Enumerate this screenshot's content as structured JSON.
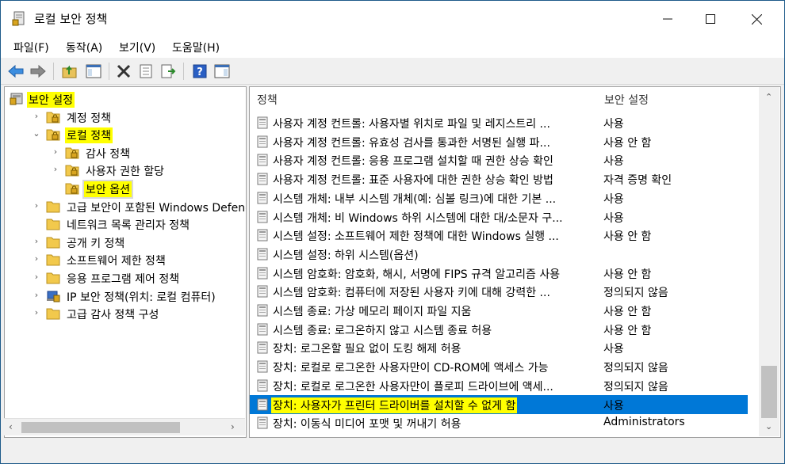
{
  "window": {
    "title": "로컬 보안 정책"
  },
  "menu": [
    "파일(F)",
    "동작(A)",
    "보기(V)",
    "도움말(H)"
  ],
  "tree": [
    {
      "label": "보안 설정",
      "level": 0,
      "arrow": "",
      "highlight": true,
      "selected": false
    },
    {
      "label": "계정 정책",
      "level": 1,
      "arrow": "›",
      "highlight": false,
      "selected": false
    },
    {
      "label": "로컬 정책",
      "level": 1,
      "arrow": "⌄",
      "highlight": true,
      "selected": false
    },
    {
      "label": "감사 정책",
      "level": 2,
      "arrow": "›",
      "highlight": false,
      "selected": false
    },
    {
      "label": "사용자 권한 할당",
      "level": 2,
      "arrow": "›",
      "highlight": false,
      "selected": false
    },
    {
      "label": "보안 옵션",
      "level": 2,
      "arrow": "",
      "highlight": true,
      "selected": true
    },
    {
      "label": "고급 보안이 포함된 Windows Defenc",
      "level": 1,
      "arrow": "›",
      "highlight": false,
      "selected": false
    },
    {
      "label": "네트워크 목록 관리자 정책",
      "level": 1,
      "arrow": "",
      "highlight": false,
      "selected": false
    },
    {
      "label": "공개 키 정책",
      "level": 1,
      "arrow": "›",
      "highlight": false,
      "selected": false
    },
    {
      "label": "소프트웨어 제한 정책",
      "level": 1,
      "arrow": "›",
      "highlight": false,
      "selected": false
    },
    {
      "label": "응용 프로그램 제어 정책",
      "level": 1,
      "arrow": "›",
      "highlight": false,
      "selected": false
    },
    {
      "label": "IP 보안 정책(위치: 로컬 컴퓨터)",
      "level": 1,
      "arrow": "›",
      "highlight": false,
      "selected": false
    },
    {
      "label": "고급 감사 정책 구성",
      "level": 1,
      "arrow": "›",
      "highlight": false,
      "selected": false
    }
  ],
  "columns": {
    "policy": "정책",
    "setting": "보안 설정"
  },
  "rows": [
    {
      "policy": "사용자 계정 컨트롤: 사용자별 위치로 파일 및 레지스트리 ...",
      "setting": "사용"
    },
    {
      "policy": "사용자 계정 컨트롤: 유효성 검사를 통과한 서명된 실행 파...",
      "setting": "사용 안 함"
    },
    {
      "policy": "사용자 계정 컨트롤: 응용 프로그램 설치할 때 권한 상승 확인",
      "setting": "사용"
    },
    {
      "policy": "사용자 계정 컨트롤: 표준 사용자에 대한 권한 상승 확인 방법",
      "setting": "자격 증명 확인"
    },
    {
      "policy": "시스템 개체: 내부 시스템 개체(예: 심볼 링크)에 대한 기본 ...",
      "setting": "사용"
    },
    {
      "policy": "시스템 개체: 비 Windows 하위 시스템에 대한 대/소문자 구...",
      "setting": "사용"
    },
    {
      "policy": "시스템 설정: 소프트웨어 제한 정책에 대한 Windows 실행 ...",
      "setting": "사용 안 함"
    },
    {
      "policy": "시스템 설정: 하위 시스템(옵션)",
      "setting": ""
    },
    {
      "policy": "시스템 암호화: 암호화, 해시, 서명에 FIPS 규격 알고리즘 사용",
      "setting": "사용 안 함"
    },
    {
      "policy": "시스템 암호화: 컴퓨터에 저장된 사용자 키에 대해 강력한 ...",
      "setting": "정의되지 않음"
    },
    {
      "policy": "시스템 종료: 가상 메모리 페이지 파일 지움",
      "setting": "사용 안 함"
    },
    {
      "policy": "시스템 종료: 로그온하지 않고 시스템 종료 허용",
      "setting": "사용 안 함"
    },
    {
      "policy": "장치: 로그온할 필요 없이 도킹 해제 허용",
      "setting": "사용"
    },
    {
      "policy": "장치: 로컬로 로그온한 사용자만이 CD-ROM에 액세스 가능",
      "setting": "정의되지 않음"
    },
    {
      "policy": "장치: 로컬로 로그온한 사용자만이 플로피 드라이브에 액세...",
      "setting": "정의되지 않음"
    },
    {
      "policy": "장치: 사용자가 프린터 드라이버를 설치할 수 없게 함",
      "setting": "사용",
      "selected": true
    },
    {
      "policy": "장치: 이동식 미디어 포맷 및 꺼내기 허용",
      "setting": "Administrators"
    }
  ],
  "colors": {
    "selection": "#0078d7",
    "highlight": "#ffff00"
  }
}
